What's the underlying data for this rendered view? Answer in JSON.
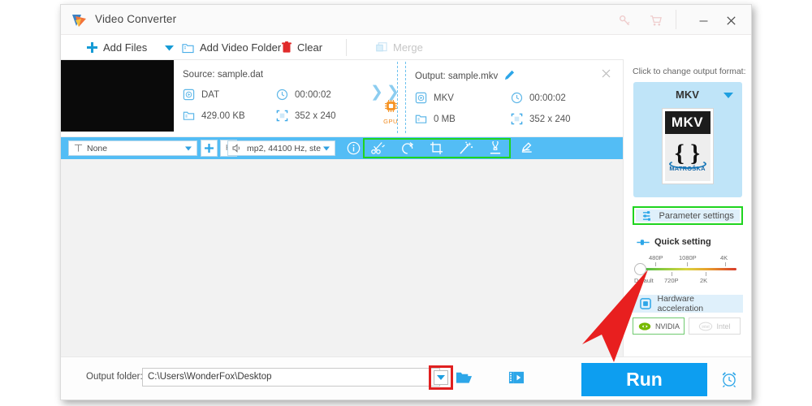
{
  "window": {
    "title": "Video Converter",
    "controls": {
      "key": "key-icon",
      "cart": "cart-icon",
      "minimize": "minimize-icon",
      "close": "close-icon"
    }
  },
  "toolbar": {
    "add_files": "Add Files",
    "add_files_caret": "caret-down-icon",
    "add_video_folder": "Add Video Folder",
    "clear": "Clear",
    "merge": "Merge"
  },
  "file_card": {
    "source_label": "Source: sample.dat",
    "source": {
      "format": "DAT",
      "duration": "00:00:02",
      "size": "429.00 KB",
      "resolution": "352 x 240"
    },
    "output_label": "Output: sample.mkv",
    "output": {
      "format": "MKV",
      "duration": "00:00:02",
      "size": "0 MB",
      "resolution": "352 x 240"
    },
    "gpu_badge": "GPU",
    "close": "close-icon",
    "edit_pencil": "pencil-icon"
  },
  "edit_bar": {
    "subtitle_value": "None",
    "subtitle_icon": "subtitle-T-icon",
    "add_button": "plus-icon",
    "hardsub_button": "H",
    "audio_value": "mp2, 44100 Hz, ste",
    "audio_icon": "speaker-icon",
    "info_icon": "info-icon",
    "tools": [
      {
        "name": "trim-icon",
        "label": "Trim"
      },
      {
        "name": "rotate-icon",
        "label": "Rotate"
      },
      {
        "name": "crop-icon",
        "label": "Crop"
      },
      {
        "name": "effects-icon",
        "label": "Effects"
      },
      {
        "name": "watermark-icon",
        "label": "Watermark"
      }
    ],
    "batch_icon": "batch-edit-icon",
    "highlight_color": "#1fd41f"
  },
  "right_panel": {
    "hint": "Click to change output format:",
    "format_name": "MKV",
    "format_caret": "caret-down-icon",
    "logo": {
      "top_text": "MKV",
      "brace": "{ }",
      "word": "MATROŠKA"
    },
    "parameter_settings": "Parameter settings",
    "parameter_icon": "sliders-icon",
    "quick_setting": "Quick setting",
    "quick_setting_icon": "slider-handle-icon",
    "slider": {
      "top_labels": [
        "480P",
        "1080P",
        "4K"
      ],
      "bottom_labels": [
        "Default",
        "720P",
        "2K"
      ],
      "value": "Default"
    },
    "hardware_acceleration": "Hardware acceleration",
    "hardware_icon": "chip-icon",
    "gpus": [
      {
        "label": "NVIDIA",
        "icon": "nvidia-icon",
        "enabled": true
      },
      {
        "label": "Intel",
        "icon": "intel-icon",
        "enabled": false
      }
    ],
    "highlight_color": "#1fd41f"
  },
  "bottom_bar": {
    "output_folder_label": "Output folder:",
    "output_folder_path": "C:\\Users\\WonderFox\\Desktop",
    "caret_icon": "caret-down-icon",
    "folder_icon": "folder-open-icon",
    "player_icon": "media-player-icon",
    "run_label": "Run",
    "clock_icon": "alarm-clock-icon",
    "run_color": "#0d9ef0",
    "highlight_color": "#e02020"
  },
  "annotations": {
    "arrow_color": "#e81f1f",
    "arrow_target": "Run"
  }
}
